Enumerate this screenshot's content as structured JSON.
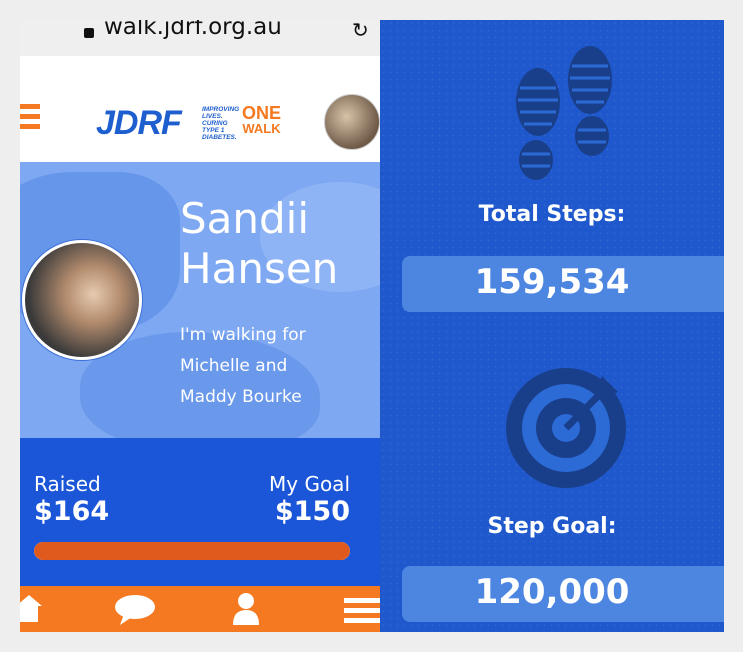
{
  "browser": {
    "url": "walk.jdrf.org.au"
  },
  "header": {
    "logo_text": "JDRF",
    "tagline": [
      "IMPROVING",
      "LIVES.",
      "CURING",
      "TYPE 1",
      "DIABETES."
    ],
    "event_line1": "ONE",
    "event_line2": "WALK"
  },
  "profile": {
    "name_line1": "Sandii",
    "name_line2": "Hansen",
    "walking_line1": "I'm walking for",
    "walking_line2": "Michelle and",
    "walking_line3": "Maddy Bourke"
  },
  "fundraising": {
    "raised_label": "Raised",
    "raised_value": "$164",
    "goal_label": "My Goal",
    "goal_value": "$150",
    "progress_percent": 100
  },
  "nav": {
    "items": [
      "home-icon",
      "chat-icon",
      "profile-icon",
      "menu-icon"
    ]
  },
  "steps": {
    "total_label": "Total Steps:",
    "total_value": "159,534",
    "goal_label": "Step Goal:",
    "goal_value": "120,000"
  },
  "colors": {
    "brand_blue": "#1e5fcf",
    "brand_orange": "#f47920",
    "progress_fill": "#e05a1e",
    "panel_blue": "#1e58cc"
  }
}
